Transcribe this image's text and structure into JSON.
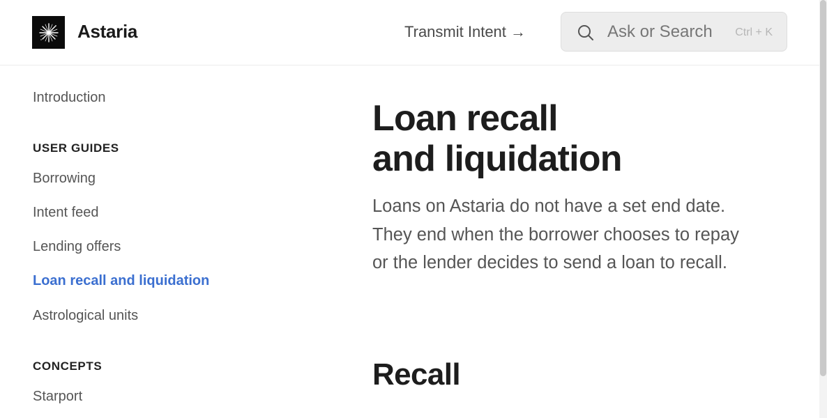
{
  "header": {
    "brand": "Astaria",
    "logo_icon": "starburst-icon",
    "transmit_label": "Transmit Intent →",
    "search": {
      "placeholder": "Ask or Search",
      "shortcut": "Ctrl + K",
      "icon": "search-icon"
    }
  },
  "sidebar": {
    "intro": "Introduction",
    "sections": [
      {
        "title": "USER GUIDES",
        "items": [
          {
            "label": "Borrowing"
          },
          {
            "label": "Intent feed"
          },
          {
            "label": "Lending offers"
          },
          {
            "label": "Loan recall and liquidation",
            "active": true
          },
          {
            "label": "Astrological units"
          }
        ]
      },
      {
        "title": "CONCEPTS",
        "items": [
          {
            "label": "Starport"
          }
        ]
      }
    ]
  },
  "main": {
    "title_line1": "Loan recall",
    "title_line2": "and liquidation",
    "lead": "Loans on Astaria do not have a set end date. They end when the borrower chooses to repay or the lender decides to send a loan to recall.",
    "section_heading": "Recall"
  },
  "colors": {
    "accent": "#3b6fd0",
    "text": "#1d1d1d",
    "muted": "#555555",
    "search_bg": "#ededed"
  }
}
